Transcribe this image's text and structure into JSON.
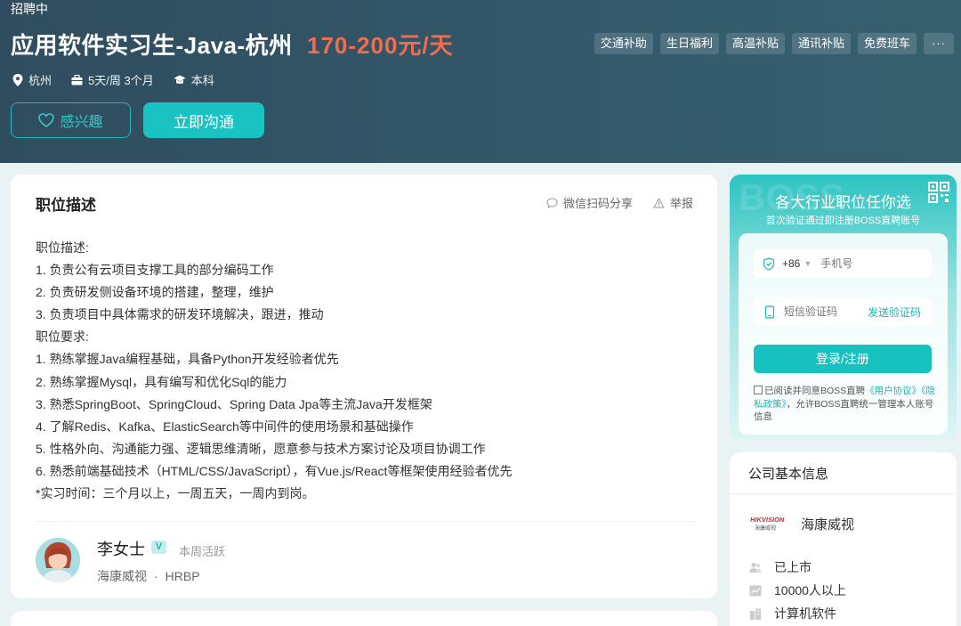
{
  "header": {
    "status": "招聘中",
    "job_title": "应用软件实习生-Java-杭州",
    "salary": "170-200元/天",
    "meta": {
      "city": "杭州",
      "schedule": "5天/周 3个月",
      "degree": "本科"
    },
    "tags": [
      "交通补助",
      "生日福利",
      "高温补贴",
      "通讯补贴",
      "免费班车"
    ],
    "more_label": "···",
    "like_label": "感兴趣",
    "chat_label": "立即沟通"
  },
  "job": {
    "section_title": "职位描述",
    "share_label": "微信扫码分享",
    "report_label": "举报",
    "description": [
      "职位描述:",
      "1. 负责公有云项目支撑工具的部分编码工作",
      "2. 负责研发侧设备环境的搭建，整理，维护",
      "3. 负责项目中具体需求的研发环境解决，跟进，推动",
      "职位要求:",
      "1. 熟练掌握Java编程基础，具备Python开发经验者优先",
      "2. 熟练掌握Mysql，具有编写和优化Sql的能力",
      "3. 熟悉SpringBoot、SpringCloud、Spring Data Jpa等主流Java开发框架",
      "4. 了解Redis、Kafka、ElasticSearch等中间件的使用场景和基础操作",
      "5. 性格外向、沟通能力强、逻辑思维清晰，愿意参与技术方案讨论及项目协调工作",
      "6. 熟悉前端基础技术（HTML/CSS/JavaScript），有Vue.js/React等框架使用经验者优先",
      "*实习时间：三个月以上，一周五天，一周内到岗。"
    ]
  },
  "recruiter": {
    "name": "李女士",
    "verified_badge": "V",
    "active": "本周活跃",
    "company": "海康威视",
    "dot": "·",
    "role": "HRBP"
  },
  "login": {
    "bg_text": "BOSS",
    "title": "各大行业职位任你选",
    "subtitle": "首次验证通过即注册BOSS直聘账号",
    "country_code": "+86",
    "phone_placeholder": "手机号",
    "code_placeholder": "短信验证码",
    "send_code": "发送验证码",
    "submit": "登录/注册",
    "agree_prefix": "已阅读并同意BOSS直聘",
    "user_agreement": "《用户协议》",
    "privacy_policy": "《隐私政策》",
    "agree_suffix": "，允许BOSS直聘统一管理本人账号信息"
  },
  "company": {
    "title": "公司基本信息",
    "logo_text": "HIKVISION",
    "logo_sub": "海康威视",
    "name": "海康威视",
    "stage": "已上市",
    "size": "10000人以上",
    "industry": "计算机软件"
  },
  "colors": {
    "accent": "#19c3c1",
    "salary": "#f26d4f",
    "header_bg": "#33586a"
  }
}
